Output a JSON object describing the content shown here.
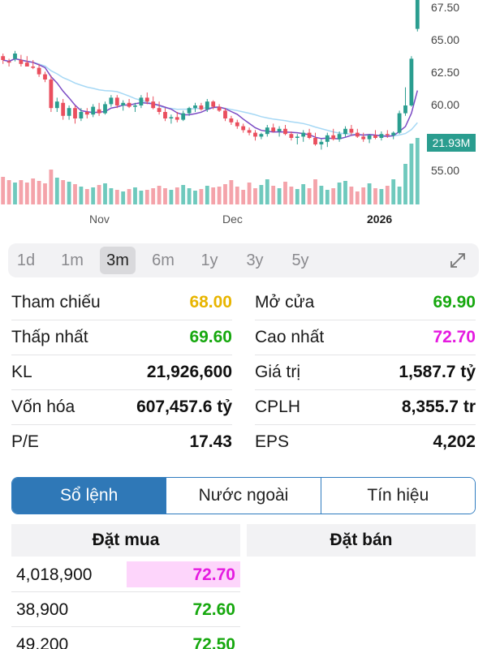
{
  "chart_data": {
    "type": "candlestick",
    "y_axis_ticks": [
      "67.50",
      "65.00",
      "62.50",
      "60.00",
      "55.00"
    ],
    "x_axis_ticks": [
      "Nov",
      "Dec",
      "2026"
    ],
    "volume_badge": "21.93M",
    "ylim": [
      52.5,
      68.5
    ],
    "candles": [
      {
        "o": 63.8,
        "h": 64.0,
        "l": 63.2,
        "c": 63.5
      },
      {
        "o": 63.4,
        "h": 63.6,
        "l": 63.0,
        "c": 63.3
      },
      {
        "o": 63.6,
        "h": 64.2,
        "l": 63.4,
        "c": 64.0
      },
      {
        "o": 63.5,
        "h": 63.9,
        "l": 63.0,
        "c": 63.2
      },
      {
        "o": 63.3,
        "h": 63.8,
        "l": 63.0,
        "c": 63.0
      },
      {
        "o": 63.0,
        "h": 63.5,
        "l": 62.8,
        "c": 62.9
      },
      {
        "o": 62.9,
        "h": 63.2,
        "l": 62.2,
        "c": 62.4
      },
      {
        "o": 62.4,
        "h": 62.6,
        "l": 61.8,
        "c": 62.0
      },
      {
        "o": 62.0,
        "h": 62.3,
        "l": 59.5,
        "c": 59.8
      },
      {
        "o": 59.8,
        "h": 60.6,
        "l": 59.5,
        "c": 60.3
      },
      {
        "o": 60.2,
        "h": 60.5,
        "l": 58.9,
        "c": 59.2
      },
      {
        "o": 59.2,
        "h": 60.0,
        "l": 58.9,
        "c": 59.8
      },
      {
        "o": 59.8,
        "h": 60.0,
        "l": 58.6,
        "c": 59.0
      },
      {
        "o": 59.0,
        "h": 59.8,
        "l": 58.8,
        "c": 59.5
      },
      {
        "o": 59.5,
        "h": 59.8,
        "l": 59.0,
        "c": 59.3
      },
      {
        "o": 59.3,
        "h": 60.1,
        "l": 59.1,
        "c": 59.9
      },
      {
        "o": 59.7,
        "h": 60.2,
        "l": 59.2,
        "c": 59.4
      },
      {
        "o": 59.4,
        "h": 60.3,
        "l": 59.3,
        "c": 60.1
      },
      {
        "o": 60.1,
        "h": 60.8,
        "l": 59.9,
        "c": 60.6
      },
      {
        "o": 60.6,
        "h": 60.8,
        "l": 59.8,
        "c": 60.0
      },
      {
        "o": 60.0,
        "h": 60.4,
        "l": 59.6,
        "c": 60.2
      },
      {
        "o": 60.2,
        "h": 60.5,
        "l": 59.8,
        "c": 59.9
      },
      {
        "o": 59.9,
        "h": 60.2,
        "l": 59.5,
        "c": 60.0
      },
      {
        "o": 60.0,
        "h": 60.8,
        "l": 59.8,
        "c": 60.6
      },
      {
        "o": 60.6,
        "h": 61.0,
        "l": 60.1,
        "c": 60.3
      },
      {
        "o": 60.3,
        "h": 60.7,
        "l": 59.7,
        "c": 59.8
      },
      {
        "o": 59.8,
        "h": 60.3,
        "l": 59.3,
        "c": 59.5
      },
      {
        "o": 59.5,
        "h": 59.8,
        "l": 58.8,
        "c": 59.0
      },
      {
        "o": 59.0,
        "h": 59.3,
        "l": 58.6,
        "c": 59.1
      },
      {
        "o": 59.1,
        "h": 59.5,
        "l": 58.7,
        "c": 58.9
      },
      {
        "o": 58.9,
        "h": 59.6,
        "l": 58.8,
        "c": 59.4
      },
      {
        "o": 59.4,
        "h": 59.9,
        "l": 59.2,
        "c": 59.8
      },
      {
        "o": 59.8,
        "h": 60.2,
        "l": 59.5,
        "c": 60.0
      },
      {
        "o": 60.0,
        "h": 60.2,
        "l": 59.6,
        "c": 59.7
      },
      {
        "o": 59.7,
        "h": 60.5,
        "l": 59.5,
        "c": 60.3
      },
      {
        "o": 60.3,
        "h": 60.4,
        "l": 59.7,
        "c": 59.9
      },
      {
        "o": 59.9,
        "h": 60.1,
        "l": 59.5,
        "c": 59.6
      },
      {
        "o": 59.6,
        "h": 59.8,
        "l": 58.8,
        "c": 59.0
      },
      {
        "o": 59.0,
        "h": 59.2,
        "l": 58.5,
        "c": 58.7
      },
      {
        "o": 58.7,
        "h": 58.9,
        "l": 58.2,
        "c": 58.4
      },
      {
        "o": 58.4,
        "h": 58.6,
        "l": 57.9,
        "c": 58.1
      },
      {
        "o": 58.1,
        "h": 58.3,
        "l": 57.7,
        "c": 57.9
      },
      {
        "o": 57.9,
        "h": 58.1,
        "l": 57.3,
        "c": 57.6
      },
      {
        "o": 57.6,
        "h": 57.9,
        "l": 57.4,
        "c": 57.8
      },
      {
        "o": 57.8,
        "h": 58.5,
        "l": 57.6,
        "c": 58.3
      },
      {
        "o": 58.3,
        "h": 58.6,
        "l": 57.9,
        "c": 58.0
      },
      {
        "o": 58.0,
        "h": 58.4,
        "l": 57.6,
        "c": 58.2
      },
      {
        "o": 58.2,
        "h": 58.5,
        "l": 57.7,
        "c": 57.8
      },
      {
        "o": 57.8,
        "h": 58.0,
        "l": 57.3,
        "c": 57.5
      },
      {
        "o": 57.5,
        "h": 57.8,
        "l": 57.0,
        "c": 57.6
      },
      {
        "o": 57.6,
        "h": 58.1,
        "l": 57.2,
        "c": 57.9
      },
      {
        "o": 57.9,
        "h": 58.2,
        "l": 57.4,
        "c": 57.5
      },
      {
        "o": 57.5,
        "h": 57.9,
        "l": 56.9,
        "c": 57.0
      },
      {
        "o": 57.0,
        "h": 57.4,
        "l": 56.6,
        "c": 57.2
      },
      {
        "o": 57.2,
        "h": 57.9,
        "l": 56.8,
        "c": 57.7
      },
      {
        "o": 57.7,
        "h": 58.2,
        "l": 57.3,
        "c": 57.4
      },
      {
        "o": 57.4,
        "h": 58.0,
        "l": 57.2,
        "c": 57.8
      },
      {
        "o": 57.8,
        "h": 58.4,
        "l": 57.6,
        "c": 58.2
      },
      {
        "o": 58.2,
        "h": 58.5,
        "l": 57.7,
        "c": 57.9
      },
      {
        "o": 57.9,
        "h": 58.2,
        "l": 57.5,
        "c": 57.6
      },
      {
        "o": 57.6,
        "h": 57.9,
        "l": 57.2,
        "c": 57.4
      },
      {
        "o": 57.4,
        "h": 57.8,
        "l": 57.1,
        "c": 57.7
      },
      {
        "o": 57.7,
        "h": 58.1,
        "l": 57.4,
        "c": 57.5
      },
      {
        "o": 57.5,
        "h": 58.0,
        "l": 57.3,
        "c": 57.8
      },
      {
        "o": 57.8,
        "h": 58.1,
        "l": 57.5,
        "c": 57.7
      },
      {
        "o": 57.7,
        "h": 58.0,
        "l": 57.4,
        "c": 57.9
      },
      {
        "o": 57.9,
        "h": 59.6,
        "l": 57.8,
        "c": 59.4
      },
      {
        "o": 59.4,
        "h": 61.4,
        "l": 59.2,
        "c": 60.0
      },
      {
        "o": 60.0,
        "h": 63.8,
        "l": 59.9,
        "c": 63.6
      },
      {
        "o": 65.9,
        "h": 68.5,
        "l": 65.7,
        "c": 68.3
      }
    ],
    "volumes": [
      0.34,
      0.3,
      0.27,
      0.3,
      0.27,
      0.32,
      0.29,
      0.26,
      0.43,
      0.33,
      0.3,
      0.28,
      0.25,
      0.22,
      0.19,
      0.21,
      0.24,
      0.26,
      0.2,
      0.18,
      0.16,
      0.19,
      0.21,
      0.17,
      0.18,
      0.2,
      0.23,
      0.2,
      0.18,
      0.21,
      0.24,
      0.2,
      0.17,
      0.19,
      0.23,
      0.21,
      0.22,
      0.25,
      0.3,
      0.22,
      0.18,
      0.27,
      0.2,
      0.24,
      0.31,
      0.23,
      0.2,
      0.28,
      0.22,
      0.19,
      0.25,
      0.2,
      0.31,
      0.23,
      0.18,
      0.2,
      0.27,
      0.29,
      0.22,
      0.16,
      0.21,
      0.26,
      0.2,
      0.19,
      0.23,
      0.31,
      0.22,
      0.5,
      0.75,
      0.82
    ],
    "volume_colors_up": [
      false,
      false,
      true,
      false,
      false,
      false,
      false,
      false,
      false,
      true,
      false,
      true,
      false,
      true,
      false,
      true,
      false,
      true,
      true,
      false,
      true,
      false,
      true,
      true,
      false,
      false,
      false,
      false,
      true,
      false,
      true,
      true,
      true,
      false,
      true,
      false,
      false,
      false,
      false,
      false,
      false,
      false,
      false,
      true,
      true,
      false,
      true,
      false,
      false,
      true,
      true,
      false,
      false,
      true,
      true,
      false,
      true,
      true,
      false,
      false,
      false,
      true,
      false,
      true,
      false,
      true,
      true,
      true,
      true,
      true
    ],
    "colors": {
      "up": "#2a9d8f",
      "down": "#ea4f5e",
      "vol_up": "#6fc9bd",
      "vol_down": "#f4a3aa",
      "ma_fast": "#7b4bc4",
      "ma_slow": "#a6d8f5",
      "badge_bg": "#2a9d8f"
    }
  },
  "periods": [
    "1d",
    "1m",
    "3m",
    "6m",
    "1y",
    "3y",
    "5y"
  ],
  "active_period": "3m",
  "stats": {
    "ref_label": "Tham chiếu",
    "ref_value": "68.00",
    "open_label": "Mở cửa",
    "open_value": "69.90",
    "low_label": "Thấp nhất",
    "low_value": "69.60",
    "high_label": "Cao nhất",
    "high_value": "72.70",
    "vol_label": "KL",
    "vol_value": "21,926,600",
    "val_label": "Giá trị",
    "val_value": "1,587.7 tỷ",
    "cap_label": "Vốn hóa",
    "cap_value": "607,457.6 tỷ",
    "cplh_label": "CPLH",
    "cplh_value": "8,355.7 tr",
    "pe_label": "P/E",
    "pe_value": "17.43",
    "eps_label": "EPS",
    "eps_value": "4,202"
  },
  "tabs": [
    "Sổ lệnh",
    "Nước ngoài",
    "Tín hiệu"
  ],
  "orderbook": {
    "buy_header": "Đặt mua",
    "sell_header": "Đặt bán",
    "buy": [
      {
        "vol": "4,018,900",
        "price": "72.70",
        "color": "#e51be0",
        "highlight": "#fdd5fb"
      },
      {
        "vol": "38,900",
        "price": "72.60",
        "color": "#17a80f",
        "highlight": ""
      },
      {
        "vol": "49,200",
        "price": "72.50",
        "color": "#17a80f",
        "highlight": ""
      }
    ]
  }
}
